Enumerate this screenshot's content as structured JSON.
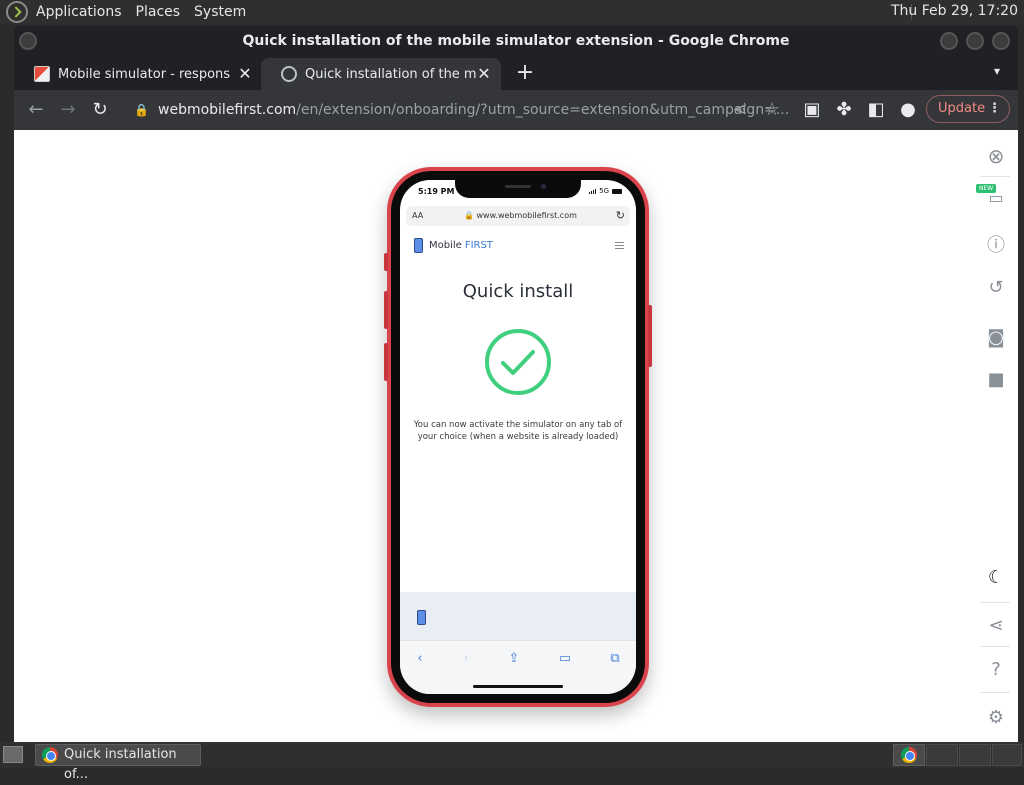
{
  "top_panel": {
    "menus": [
      "Applications",
      "Places",
      "System"
    ],
    "clock": "Thu Feb 29, 17:20"
  },
  "window": {
    "title": "Quick installation of the mobile simulator extension - Google Chrome"
  },
  "tabs": [
    {
      "title": "Mobile simulator - responsive",
      "active": false
    },
    {
      "title": "Quick installation of the mobi",
      "active": true
    }
  ],
  "toolbar": {
    "url_host": "webmobilefirst.com",
    "url_path": "/en/extension/onboarding/?utm_source=extension&utm_campaign=...",
    "update_label": "Update"
  },
  "phone": {
    "status_time": "5:19 PM",
    "network": "5G",
    "aa": "AA",
    "address": "www.webmobilefirst.com",
    "brand": "Mobile",
    "brand_accent": "FIRST",
    "heading": "Quick install",
    "message": "You can now activate the simulator on any tab of your choice (when a website is already loaded)",
    "new_badge": "NEW"
  },
  "taskbar": {
    "item_label": "Quick installation of..."
  },
  "colors": {
    "phone_frame": "#d9434b",
    "check_green": "#3fcf7f",
    "update_text": "#f28b82"
  }
}
